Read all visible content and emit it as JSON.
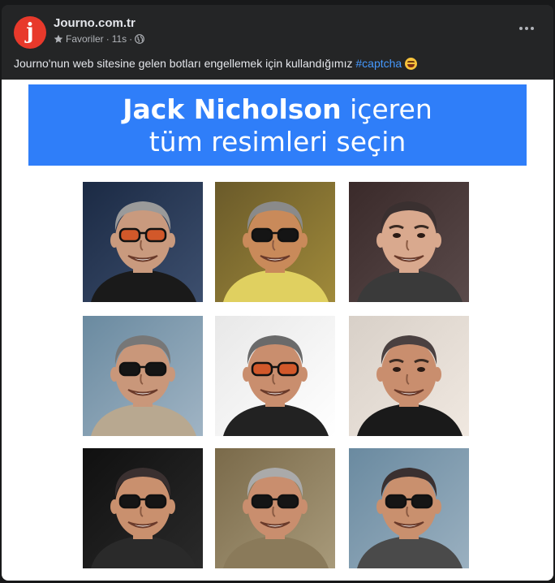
{
  "post": {
    "page_name": "Journo.com.tr",
    "avatar_letter": "j",
    "audience": "Favoriler",
    "separator": "·",
    "time": "11s",
    "caption": "Journo'nun web sitesine gelen botları engellemek için kullandığımız ",
    "hashtag": "#captcha",
    "emoji_icon": "laughing-tears-emoji-icon"
  },
  "captcha": {
    "name_bold": "Jack Nicholson",
    "line1_rest": " içeren",
    "line2": "tüm resimleri seçin",
    "banner_color": "#2f7ef9",
    "tiles": [
      {
        "bg1": "#1b2a44",
        "bg2": "#3d4f6e",
        "skin": "#c99a7e",
        "hair": "#9a9a9a",
        "shirt": "#1a1a1a",
        "glasses": "orange"
      },
      {
        "bg1": "#6a5a2a",
        "bg2": "#a08a3a",
        "skin": "#c98a5a",
        "hair": "#8a8a8a",
        "shirt": "#e0d060",
        "glasses": "dark"
      },
      {
        "bg1": "#3a2a2a",
        "bg2": "#5a4a4a",
        "skin": "#d9a98e",
        "hair": "#3a3030",
        "shirt": "#3a3a3a",
        "glasses": "none"
      },
      {
        "bg1": "#6a8aa0",
        "bg2": "#a0b4c4",
        "skin": "#c9977a",
        "hair": "#777777",
        "shirt": "#b8a890",
        "glasses": "dark"
      },
      {
        "bg1": "#e8e8e8",
        "bg2": "#ffffff",
        "skin": "#c98e6e",
        "hair": "#6a6a6a",
        "shirt": "#222222",
        "glasses": "orange"
      },
      {
        "bg1": "#d8d0c8",
        "bg2": "#f0e8e0",
        "skin": "#c98e6e",
        "hair": "#4a4040",
        "shirt": "#1a1a1a",
        "glasses": "none"
      },
      {
        "bg1": "#101010",
        "bg2": "#2a2a2a",
        "skin": "#c9906e",
        "hair": "#3a3030",
        "shirt": "#2a2a2a",
        "glasses": "dark"
      },
      {
        "bg1": "#7a6a4a",
        "bg2": "#a89a7a",
        "skin": "#c98e6e",
        "hair": "#aaaaaa",
        "shirt": "#8a7a5a",
        "glasses": "dark"
      },
      {
        "bg1": "#6a8aa0",
        "bg2": "#9ab0c0",
        "skin": "#c9906e",
        "hair": "#3a3030",
        "shirt": "#4a4a4a",
        "glasses": "dark"
      }
    ]
  }
}
